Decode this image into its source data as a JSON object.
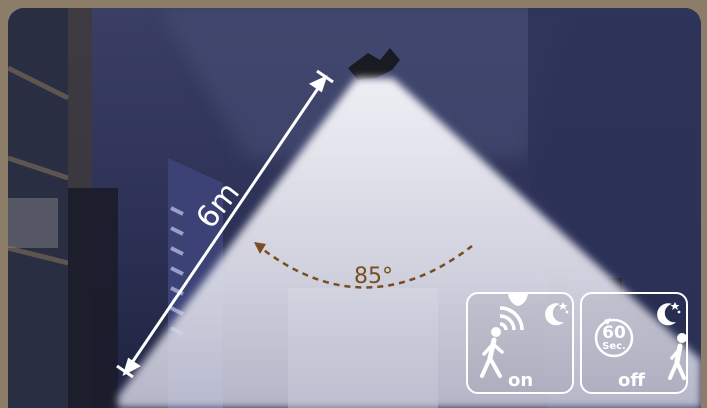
{
  "distance": "6m",
  "angle": "85°",
  "badges": [
    {
      "state": "on",
      "icons": [
        "motion-sensor-icon",
        "walking-person-icon",
        "moon-stars-icon",
        "light-on-icon"
      ]
    },
    {
      "state": "off",
      "timer_value": "60",
      "timer_unit": "Sec.",
      "icons": [
        "timer-icon",
        "walking-person-icon",
        "moon-stars-icon"
      ]
    }
  ],
  "colors": {
    "frame": "#8c7d68",
    "angle_arc": "#7a4c22",
    "badge_border": "#ffffff"
  }
}
